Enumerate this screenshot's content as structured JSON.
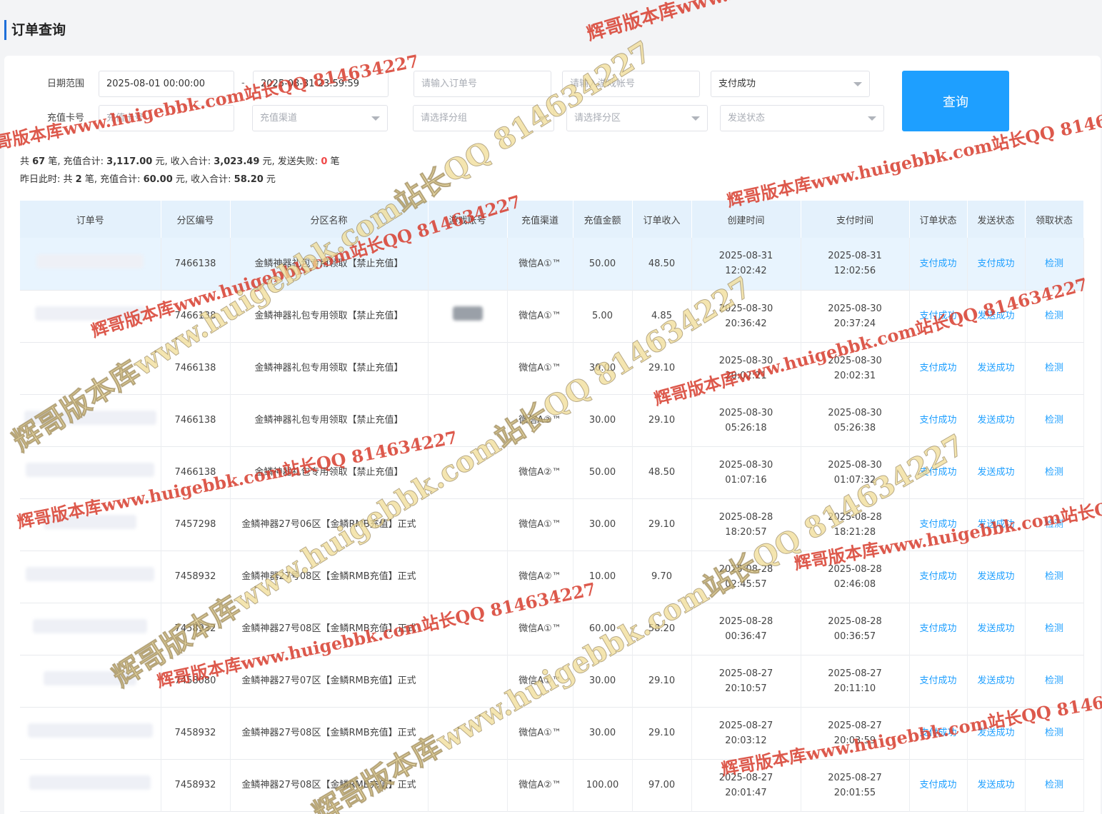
{
  "page_title": "订单查询",
  "filters": {
    "date_range_label": "日期范围",
    "date_start": "2025-08-01 00:00:00",
    "date_separator": "-",
    "date_end": "2025-08-31 23:59:59",
    "order_no_placeholder": "请输入订单号",
    "game_account_placeholder": "请输入游戏帐号",
    "pay_status_value": "支付成功",
    "card_label": "充值卡号",
    "card_placeholder": "充值卡号",
    "channel_placeholder": "充值渠道",
    "group_placeholder": "请选择分组",
    "zone_placeholder": "请选择分区",
    "send_status_placeholder": "发送状态",
    "query_button": "查询"
  },
  "summary": {
    "line1": {
      "t1": "共 ",
      "count": "67",
      "t2": " 笔, 充值合计: ",
      "recharge": "3,117.00",
      "t3": " 元, 收入合计: ",
      "income": "3,023.49",
      "t4": " 元, 发送失败: ",
      "failed": "0",
      "t5": " 笔"
    },
    "line2": {
      "t1": "昨日此时: 共 ",
      "count": "2",
      "t2": " 笔, 充值合计: ",
      "recharge": "60.00",
      "t3": " 元, 收入合计: ",
      "income": "58.20",
      "t4": " 元"
    }
  },
  "table": {
    "headers": [
      "订单号",
      "分区编号",
      "分区名称",
      "游戏账号",
      "充值渠道",
      "充值金额",
      "订单收入",
      "创建时间",
      "支付时间",
      "订单状态",
      "发送状态",
      "领取状态"
    ],
    "rows": [
      {
        "zone_id": "7466138",
        "zone_name": "金鳞神器礼包专用领取【禁止充值】",
        "channel": "微信A①™",
        "amount": "50.00",
        "income": "48.50",
        "created_date": "2025-08-31",
        "created_time": "12:02:42",
        "paid_date": "2025-08-31",
        "paid_time": "12:02:56",
        "order_status": "支付成功",
        "send_status": "支付成功",
        "claim_status": "检测"
      },
      {
        "zone_id": "7466138",
        "zone_name": "金鳞神器礼包专用领取【禁止充值】",
        "channel": "微信A①™",
        "amount": "5.00",
        "income": "4.85",
        "created_date": "2025-08-30",
        "created_time": "20:36:42",
        "paid_date": "2025-08-30",
        "paid_time": "20:37:24",
        "order_status": "支付成功",
        "send_status": "发送成功",
        "claim_status": "检测"
      },
      {
        "zone_id": "7466138",
        "zone_name": "金鳞神器礼包专用领取【禁止充值】",
        "channel": "微信A①™",
        "amount": "30.00",
        "income": "29.10",
        "created_date": "2025-08-30",
        "created_time": "20:02:21",
        "paid_date": "2025-08-30",
        "paid_time": "20:02:31",
        "order_status": "支付成功",
        "send_status": "发送成功",
        "claim_status": "检测"
      },
      {
        "zone_id": "7466138",
        "zone_name": "金鳞神器礼包专用领取【禁止充值】",
        "channel": "微信A②™",
        "amount": "30.00",
        "income": "29.10",
        "created_date": "2025-08-30",
        "created_time": "05:26:18",
        "paid_date": "2025-08-30",
        "paid_time": "05:26:38",
        "order_status": "支付成功",
        "send_status": "发送成功",
        "claim_status": "检测"
      },
      {
        "zone_id": "7466138",
        "zone_name": "金鳞神器礼包专用领取【禁止充值】",
        "channel": "微信A②™",
        "amount": "50.00",
        "income": "48.50",
        "created_date": "2025-08-30",
        "created_time": "01:07:16",
        "paid_date": "2025-08-30",
        "paid_time": "01:07:32",
        "order_status": "支付成功",
        "send_status": "发送成功",
        "claim_status": "检测"
      },
      {
        "zone_id": "7457298",
        "zone_name": "金鳞神器27号06区【金鳞RMB充值】正式",
        "channel": "微信A①™",
        "amount": "30.00",
        "income": "29.10",
        "created_date": "2025-08-28",
        "created_time": "18:20:57",
        "paid_date": "2025-08-28",
        "paid_time": "18:21:28",
        "order_status": "支付成功",
        "send_status": "发送成功",
        "claim_status": "检测"
      },
      {
        "zone_id": "7458932",
        "zone_name": "金鳞神器27号08区【金鳞RMB充值】正式",
        "channel": "微信A②™",
        "amount": "10.00",
        "income": "9.70",
        "created_date": "2025-08-28",
        "created_time": "02:45:57",
        "paid_date": "2025-08-28",
        "paid_time": "02:46:08",
        "order_status": "支付成功",
        "send_status": "发送成功",
        "claim_status": "检测"
      },
      {
        "zone_id": "7458932",
        "zone_name": "金鳞神器27号08区【金鳞RMB充值】正式",
        "channel": "微信A①™",
        "amount": "60.00",
        "income": "58.20",
        "created_date": "2025-08-28",
        "created_time": "00:36:47",
        "paid_date": "2025-08-28",
        "paid_time": "00:36:57",
        "order_status": "支付成功",
        "send_status": "发送成功",
        "claim_status": "检测"
      },
      {
        "zone_id": "7458080",
        "zone_name": "金鳞神器27号07区【金鳞RMB充值】正式",
        "channel": "微信A①™",
        "amount": "30.00",
        "income": "29.10",
        "created_date": "2025-08-27",
        "created_time": "20:10:57",
        "paid_date": "2025-08-27",
        "paid_time": "20:11:10",
        "order_status": "支付成功",
        "send_status": "发送成功",
        "claim_status": "检测"
      },
      {
        "zone_id": "7458932",
        "zone_name": "金鳞神器27号08区【金鳞RMB充值】正式",
        "channel": "微信A①™",
        "amount": "30.00",
        "income": "29.10",
        "created_date": "2025-08-27",
        "created_time": "20:03:12",
        "paid_date": "2025-08-27",
        "paid_time": "20:03:59",
        "order_status": "支付成功",
        "send_status": "发送成功",
        "claim_status": "检测"
      },
      {
        "zone_id": "7458932",
        "zone_name": "金鳞神器27号08区【金鳞RMB充值】正式",
        "channel": "微信A②™",
        "amount": "100.00",
        "income": "97.00",
        "created_date": "2025-08-27",
        "created_time": "20:01:47",
        "paid_date": "2025-08-27",
        "paid_time": "20:01:55",
        "order_status": "支付成功",
        "send_status": "发送成功",
        "claim_status": "检测"
      }
    ]
  },
  "watermarks": {
    "red": "辉哥版本库www.huigebbk.com站长QQ 814634227",
    "big": "辉哥版本库www.huigebbk.com站长QQ 814634227",
    "red_color": "#d73c2d",
    "big_color": "#f0dc96"
  }
}
